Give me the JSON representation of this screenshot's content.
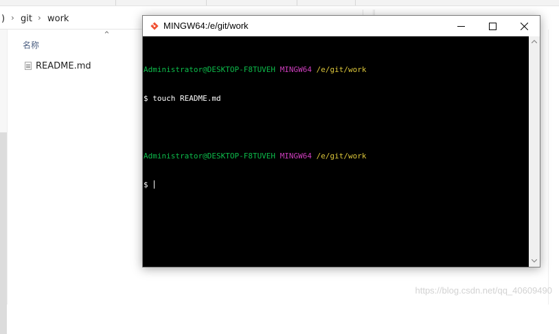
{
  "explorer": {
    "breadcrumb": {
      "root_fragment": ")",
      "items": [
        "git",
        "work"
      ]
    },
    "columns": {
      "name": "名称"
    },
    "files": [
      {
        "name": "README.md",
        "icon": "text-file-icon"
      }
    ]
  },
  "terminal": {
    "title": "MINGW64:/e/git/work",
    "icon": "git-diamond-icon",
    "lines": [
      {
        "type": "prompt",
        "user": "Administrator@DESKTOP-F8TUVEH",
        "host": "MINGW64",
        "path": "/e/git/work"
      },
      {
        "type": "command",
        "text": "$ touch README.md"
      },
      {
        "type": "blank",
        "text": ""
      },
      {
        "type": "prompt",
        "user": "Administrator@DESKTOP-F8TUVEH",
        "host": "MINGW64",
        "path": "/e/git/work"
      },
      {
        "type": "command",
        "text": "$ "
      }
    ],
    "colors": {
      "user": "#0dbc4b",
      "host": "#ce3ebd",
      "path": "#dcc63a",
      "background": "#000000"
    }
  },
  "watermark": "https://blog.csdn.net/qq_40609490"
}
